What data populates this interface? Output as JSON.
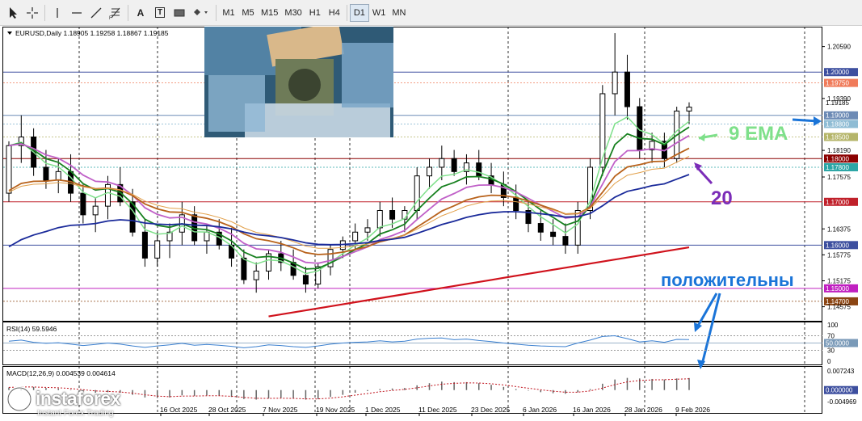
{
  "toolbar": {
    "timeframes": [
      "M1",
      "M5",
      "M15",
      "M30",
      "H1",
      "H4",
      "D1",
      "W1",
      "MN"
    ],
    "active_timeframe": "D1",
    "tools": [
      "cursor-icon",
      "crosshair-icon",
      "vertical-line-icon",
      "horizontal-line-icon",
      "trendline-icon",
      "fibonacci-icon",
      "text-icon",
      "label-icon",
      "rectangle-icon",
      "shapes-icon"
    ],
    "tool_labels": {
      "text": "A",
      "label": "T"
    }
  },
  "chart_data": [
    {
      "type": "candlestick",
      "title": "EURUSD,Daily  1.18905 1.19258 1.18867 1.19185",
      "ylim": [
        1.1425,
        1.2105
      ],
      "y_ticks": [
        1.2059,
        1.1939,
        1.1819,
        1.17575,
        1.16375,
        1.15775,
        1.15175,
        1.14575
      ],
      "x_ticks": [
        "16 Oct 2025",
        "28 Oct 2025",
        "7 Nov 2025",
        "19 Nov 2025",
        "1 Dec 2025",
        "11 Dec 2025",
        "23 Dec 2025",
        "6 Jan 2026",
        "16 Jan 2026",
        "28 Jan 2026",
        "9 Feb 2026"
      ],
      "price_levels": [
        {
          "value": 1.2,
          "label": "1.20000",
          "color": "#3d4f9f",
          "style": "solid"
        },
        {
          "value": 1.1975,
          "label": "1.19750",
          "color": "#f07b5a",
          "style": "dotted"
        },
        {
          "value": 1.19185,
          "label": "1.19185",
          "color": "#000000",
          "style": "none"
        },
        {
          "value": 1.19,
          "label": "1.19000",
          "color": "#6c8ab5",
          "style": "solid"
        },
        {
          "value": 1.188,
          "label": "1.18800",
          "color": "#8fbcd4",
          "style": "dotted"
        },
        {
          "value": 1.185,
          "label": "1.18500",
          "color": "#b5b56a",
          "style": "dotted"
        },
        {
          "value": 1.18,
          "label": "1.18000",
          "color": "#8b0000",
          "style": "solid"
        },
        {
          "value": 1.178,
          "label": "1.17800",
          "color": "#2aa5a5",
          "style": "dotted"
        },
        {
          "value": 1.17,
          "label": "1.17000",
          "color": "#c0202a",
          "style": "solid"
        },
        {
          "value": 1.16,
          "label": "1.16000",
          "color": "#3d4f9f",
          "style": "solid"
        },
        {
          "value": 1.15,
          "label": "1.15000",
          "color": "#c020c0",
          "style": "solid"
        },
        {
          "value": 1.147,
          "label": "1.14700",
          "color": "#8b4513",
          "style": "dotted"
        }
      ],
      "candles": [
        [
          1.172,
          1.184,
          1.17,
          1.183
        ],
        [
          1.183,
          1.19,
          1.179,
          1.185
        ],
        [
          1.185,
          1.187,
          1.176,
          1.178
        ],
        [
          1.178,
          1.182,
          1.173,
          1.175
        ],
        [
          1.175,
          1.18,
          1.172,
          1.177
        ],
        [
          1.177,
          1.181,
          1.17,
          1.172
        ],
        [
          1.172,
          1.174,
          1.165,
          1.167
        ],
        [
          1.167,
          1.171,
          1.163,
          1.169
        ],
        [
          1.169,
          1.176,
          1.166,
          1.174
        ],
        [
          1.174,
          1.178,
          1.169,
          1.17
        ],
        [
          1.17,
          1.173,
          1.162,
          1.163
        ],
        [
          1.163,
          1.166,
          1.155,
          1.157
        ],
        [
          1.157,
          1.163,
          1.155,
          1.161
        ],
        [
          1.161,
          1.165,
          1.157,
          1.163
        ],
        [
          1.163,
          1.17,
          1.16,
          1.167
        ],
        [
          1.167,
          1.169,
          1.16,
          1.161
        ],
        [
          1.161,
          1.165,
          1.158,
          1.163
        ],
        [
          1.163,
          1.166,
          1.159,
          1.16
        ],
        [
          1.16,
          1.164,
          1.155,
          1.157
        ],
        [
          1.157,
          1.159,
          1.151,
          1.152
        ],
        [
          1.152,
          1.156,
          1.149,
          1.154
        ],
        [
          1.154,
          1.159,
          1.152,
          1.158
        ],
        [
          1.158,
          1.161,
          1.154,
          1.156
        ],
        [
          1.156,
          1.159,
          1.152,
          1.153
        ],
        [
          1.153,
          1.155,
          1.149,
          1.151
        ],
        [
          1.151,
          1.156,
          1.15,
          1.155
        ],
        [
          1.155,
          1.16,
          1.153,
          1.159
        ],
        [
          1.159,
          1.162,
          1.157,
          1.161
        ],
        [
          1.161,
          1.165,
          1.159,
          1.163
        ],
        [
          1.163,
          1.166,
          1.161,
          1.164
        ],
        [
          1.164,
          1.17,
          1.162,
          1.168
        ],
        [
          1.168,
          1.171,
          1.164,
          1.166
        ],
        [
          1.166,
          1.169,
          1.163,
          1.168
        ],
        [
          1.168,
          1.178,
          1.166,
          1.176
        ],
        [
          1.176,
          1.18,
          1.173,
          1.178
        ],
        [
          1.178,
          1.183,
          1.175,
          1.18
        ],
        [
          1.18,
          1.182,
          1.176,
          1.177
        ],
        [
          1.177,
          1.181,
          1.174,
          1.179
        ],
        [
          1.179,
          1.182,
          1.175,
          1.176
        ],
        [
          1.176,
          1.179,
          1.172,
          1.174
        ],
        [
          1.174,
          1.177,
          1.169,
          1.171
        ],
        [
          1.171,
          1.174,
          1.166,
          1.168
        ],
        [
          1.168,
          1.17,
          1.163,
          1.165
        ],
        [
          1.165,
          1.168,
          1.161,
          1.163
        ],
        [
          1.163,
          1.166,
          1.16,
          1.162
        ],
        [
          1.162,
          1.165,
          1.158,
          1.16
        ],
        [
          1.16,
          1.17,
          1.158,
          1.168
        ],
        [
          1.168,
          1.18,
          1.166,
          1.178
        ],
        [
          1.178,
          1.197,
          1.176,
          1.195
        ],
        [
          1.195,
          1.209,
          1.19,
          1.2
        ],
        [
          1.2,
          1.204,
          1.189,
          1.192
        ],
        [
          1.192,
          1.194,
          1.18,
          1.182
        ],
        [
          1.182,
          1.186,
          1.179,
          1.184
        ],
        [
          1.184,
          1.186,
          1.178,
          1.18
        ],
        [
          1.18,
          1.192,
          1.179,
          1.191
        ],
        [
          1.191,
          1.193,
          1.188,
          1.1919
        ]
      ],
      "indicators": [
        "EMA 9",
        "EMA 20",
        "MA 50",
        "MA 100",
        "MA 200"
      ]
    },
    {
      "type": "line",
      "title": "RSI(14) 59.5946",
      "ylim": [
        0,
        100
      ],
      "y_ticks": [
        100,
        70,
        50,
        30,
        0
      ],
      "levels": [
        {
          "value": 50,
          "label": "50.0000"
        }
      ],
      "values": [
        55,
        58,
        52,
        49,
        51,
        47,
        43,
        46,
        50,
        47,
        42,
        38,
        42,
        45,
        49,
        44,
        46,
        44,
        41,
        37,
        40,
        45,
        43,
        40,
        38,
        42,
        47,
        50,
        52,
        53,
        56,
        53,
        55,
        61,
        63,
        64,
        59,
        61,
        57,
        54,
        50,
        47,
        44,
        42,
        41,
        40,
        50,
        58,
        68,
        70,
        62,
        53,
        56,
        52,
        60,
        59.59
      ]
    },
    {
      "type": "bar",
      "title": "MACD(12,26,9) 0.004539 0.004614",
      "ylim": [
        -0.004969,
        0.007243
      ],
      "y_ticks": [
        0.007243,
        0.0,
        -0.004969
      ],
      "labels": {
        "top": "0.007243",
        "zero": "0.000000",
        "bottom": "-0.004969"
      },
      "values": [
        0.001,
        0.0014,
        0.0012,
        0.0008,
        0.0006,
        0.0002,
        -0.0006,
        -0.001,
        -0.0008,
        -0.001,
        -0.0018,
        -0.0028,
        -0.003,
        -0.0028,
        -0.002,
        -0.0022,
        -0.002,
        -0.0022,
        -0.0026,
        -0.0034,
        -0.0036,
        -0.0032,
        -0.003,
        -0.0032,
        -0.0036,
        -0.0034,
        -0.0026,
        -0.0018,
        -0.001,
        -0.0004,
        0.0004,
        0.0006,
        0.0008,
        0.0018,
        0.0026,
        0.0032,
        0.003,
        0.003,
        0.0026,
        0.002,
        0.0012,
        0.0004,
        -0.0002,
        -0.0008,
        -0.0012,
        -0.0014,
        -0.0008,
        0.0004,
        0.0024,
        0.004,
        0.0046,
        0.0044,
        0.0042,
        0.004,
        0.0044,
        0.004539
      ]
    }
  ],
  "annotations": {
    "ema_label": "9 EMA",
    "ma_label": "20",
    "positive_label": "положительны"
  },
  "colors": {
    "ema9": "#7ee08a",
    "ema20": "#16801e",
    "ma50": "#c060c8",
    "ma100": "#b8621b",
    "ma100_thin": "#e2a04a",
    "ma_blue": "#1a2a9a",
    "ma200": "#d0121c",
    "arrow_blue": "#1a74d8",
    "rsi": "#3a7fcf",
    "macd_signal": "#c0121c"
  },
  "logo": {
    "name": "instaforex",
    "tagline": "Instant Forex Trading"
  }
}
